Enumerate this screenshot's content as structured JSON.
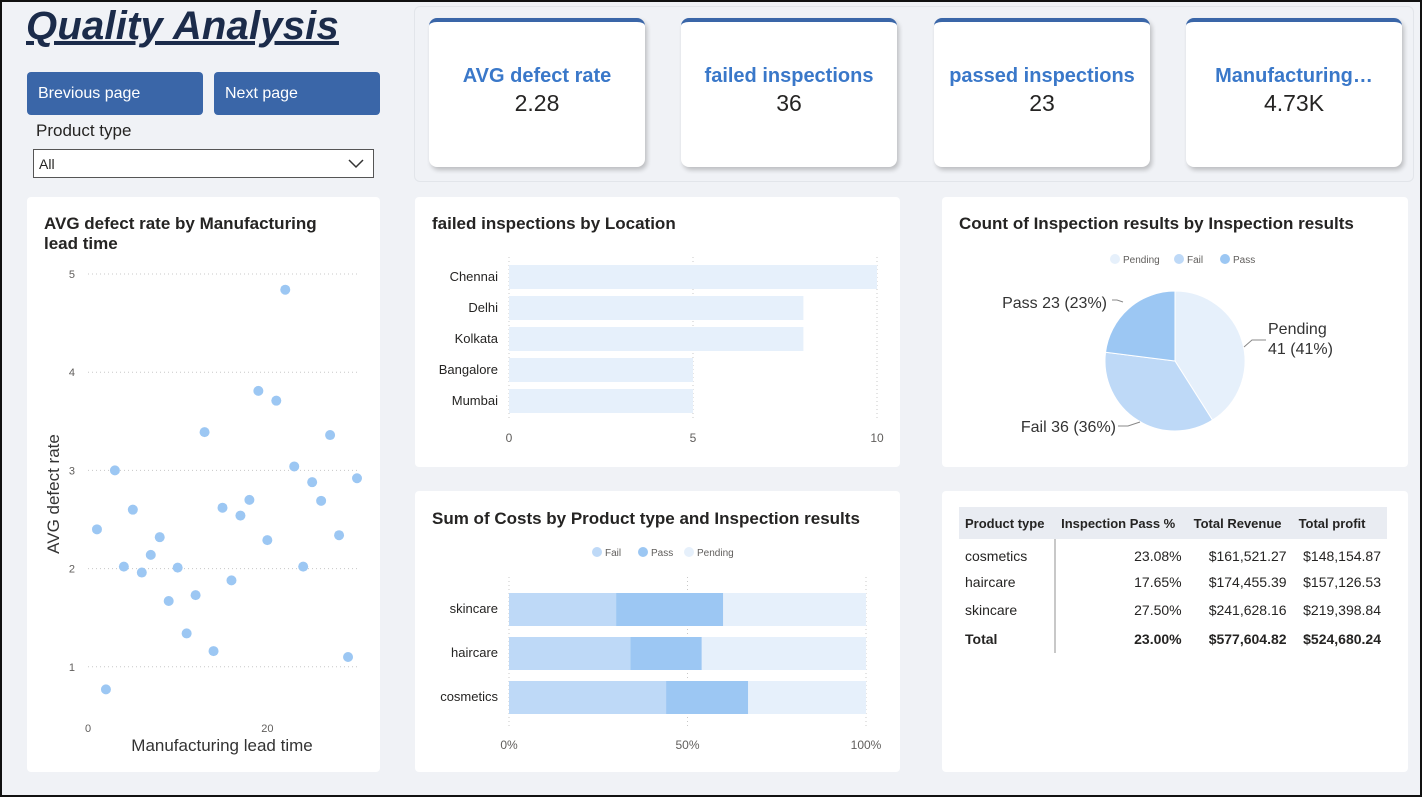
{
  "page": {
    "title": "Quality Analysis",
    "prev_label": "Brevious page",
    "next_label": "Next page"
  },
  "slicer": {
    "label": "Product type",
    "value": "All"
  },
  "kpis": [
    {
      "label": "AVG defect rate",
      "value": "2.28"
    },
    {
      "label": "failed inspections",
      "value": "36"
    },
    {
      "label": "passed inspections",
      "value": "23"
    },
    {
      "label": "Manufacturing…",
      "value": "4.73K"
    }
  ],
  "colors": {
    "accent": "#3a66a8",
    "kpi_label": "#3a78c9",
    "fail": "#bed9f7",
    "pass": "#9cc7f3",
    "pending": "#e6f0fb"
  },
  "scatter": {
    "title_line1": "AVG defect rate by Manufacturing",
    "title_line2": "lead time",
    "chart_data": {
      "type": "scatter",
      "xlabel": "Manufacturing lead time",
      "ylabel": "AVG defect rate",
      "x_ticks": [
        "0",
        "20"
      ],
      "y_ticks": [
        "1",
        "2",
        "3",
        "4",
        "5"
      ],
      "xlim": [
        0,
        30
      ],
      "ylim": [
        0,
        5
      ],
      "points": [
        [
          1,
          2.4
        ],
        [
          2,
          0.77
        ],
        [
          3,
          3.0
        ],
        [
          4,
          2.02
        ],
        [
          5,
          2.6
        ],
        [
          6,
          1.96
        ],
        [
          7,
          2.14
        ],
        [
          8,
          2.32
        ],
        [
          9,
          1.67
        ],
        [
          10,
          2.01
        ],
        [
          11,
          1.34
        ],
        [
          12,
          1.73
        ],
        [
          13,
          3.39
        ],
        [
          14,
          1.16
        ],
        [
          15,
          2.62
        ],
        [
          16,
          1.88
        ],
        [
          17,
          2.54
        ],
        [
          18,
          2.7
        ],
        [
          19,
          3.81
        ],
        [
          20,
          2.29
        ],
        [
          21,
          3.71
        ],
        [
          22,
          4.84
        ],
        [
          23,
          3.04
        ],
        [
          24,
          2.02
        ],
        [
          25,
          2.88
        ],
        [
          26,
          2.69
        ],
        [
          27,
          3.36
        ],
        [
          28,
          2.34
        ],
        [
          29,
          1.1
        ],
        [
          30,
          2.92
        ]
      ]
    }
  },
  "location_bar": {
    "title": "failed inspections by Location",
    "chart_data": {
      "type": "bar",
      "orientation": "horizontal",
      "categories": [
        "Chennai",
        "Delhi",
        "Kolkata",
        "Bangalore",
        "Mumbai"
      ],
      "values": [
        10,
        8,
        8,
        5,
        5
      ],
      "x_ticks": [
        "0",
        "5",
        "10"
      ],
      "xlim": [
        0,
        10
      ]
    }
  },
  "pie": {
    "title": "Count of Inspection results by Inspection results",
    "chart_data": {
      "type": "pie",
      "legend": [
        "Pending",
        "Fail",
        "Pass"
      ],
      "slices": [
        {
          "label": "Pending",
          "value": 41,
          "pct": "41%",
          "text_line1": "Pending",
          "text_line2": "41 (41%)"
        },
        {
          "label": "Fail",
          "value": 36,
          "pct": "36%",
          "text": "Fail 36 (36%)"
        },
        {
          "label": "Pass",
          "value": 23,
          "pct": "23%",
          "text": "Pass 23 (23%)"
        }
      ]
    }
  },
  "stacked": {
    "title": "Sum of Costs by Product type and Inspection results",
    "chart_data": {
      "type": "bar",
      "stacking": "100%",
      "orientation": "horizontal",
      "legend": [
        "Fail",
        "Pass",
        "Pending"
      ],
      "categories": [
        "skincare",
        "haircare",
        "cosmetics"
      ],
      "series": [
        {
          "name": "Fail",
          "values": [
            30,
            34,
            44
          ]
        },
        {
          "name": "Pass",
          "values": [
            30,
            20,
            23
          ]
        },
        {
          "name": "Pending",
          "values": [
            40,
            46,
            33
          ]
        }
      ],
      "x_ticks": [
        "0%",
        "50%",
        "100%"
      ]
    }
  },
  "table": {
    "headers": [
      "Product type",
      "Inspection Pass %",
      "Total Revenue",
      "Total profit"
    ],
    "rows": [
      [
        "cosmetics",
        "23.08%",
        "$161,521.27",
        "$148,154.87"
      ],
      [
        "haircare",
        "17.65%",
        "$174,455.39",
        "$157,126.53"
      ],
      [
        "skincare",
        "27.50%",
        "$241,628.16",
        "$219,398.84"
      ]
    ],
    "total": [
      "Total",
      "23.00%",
      "$577,604.82",
      "$524,680.24"
    ]
  }
}
